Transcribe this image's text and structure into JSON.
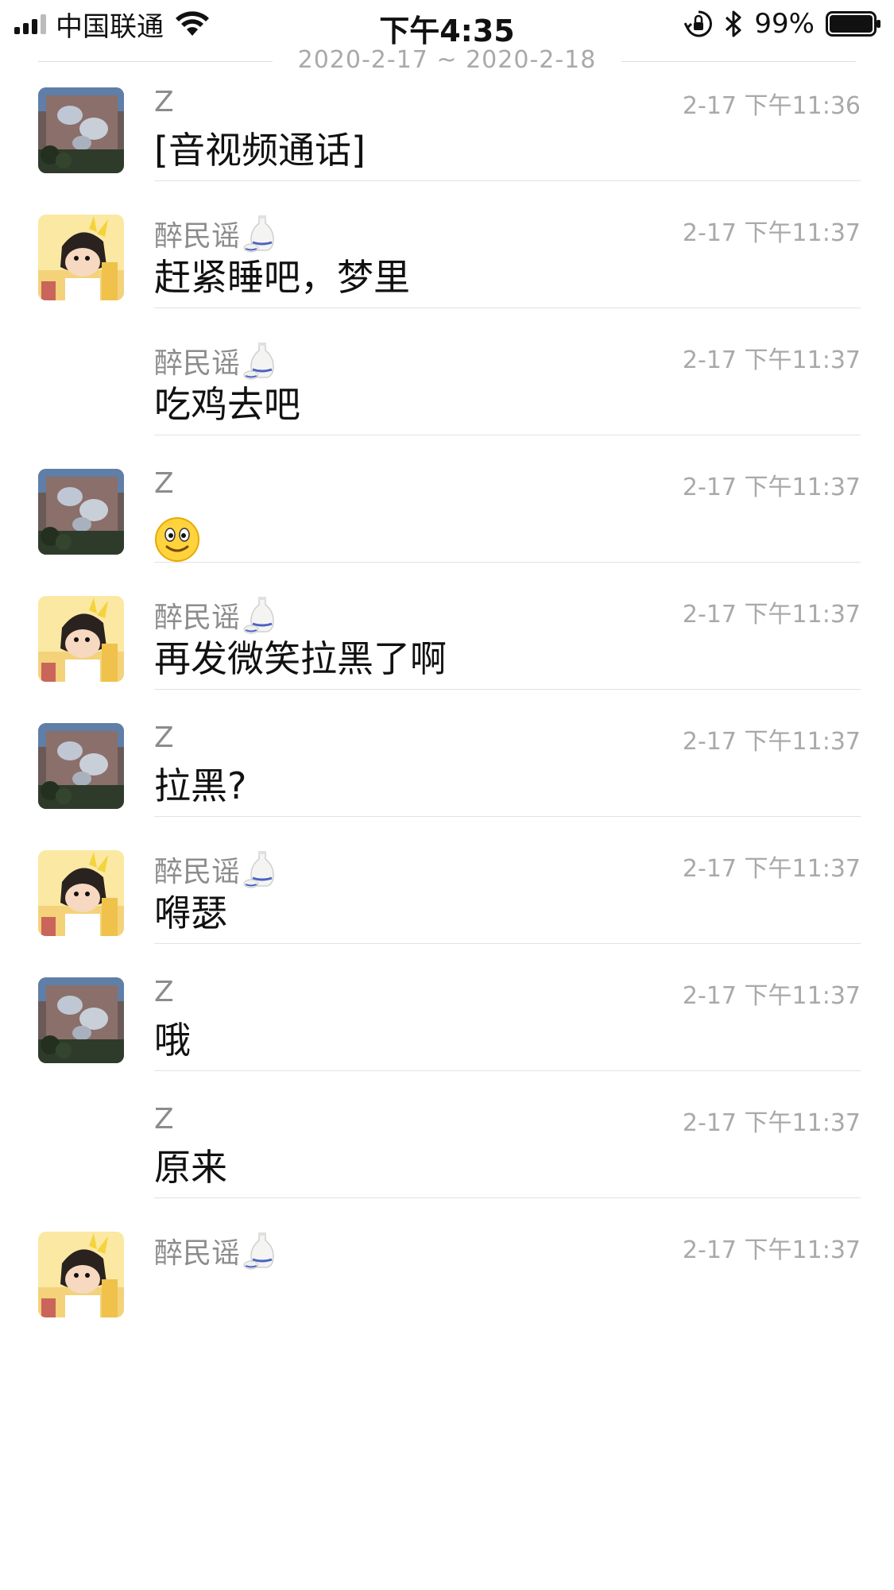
{
  "status_bar": {
    "carrier": "中国联通",
    "time": "下午4:35",
    "battery_percent": "99%",
    "icons": [
      "signal-icon",
      "wifi-icon",
      "orientation-lock-icon",
      "bluetooth-icon",
      "battery-icon"
    ]
  },
  "date_header": {
    "range": "2020-2-17 ~ 2020-2-18"
  },
  "messages": [
    {
      "sender": "Z",
      "time": "2-17 下午11:36",
      "text": "[音视频通话]",
      "avatar": "avatar-z",
      "emoji": ""
    },
    {
      "sender": "醉民谣",
      "time": "2-17 下午11:37",
      "text": "赶紧睡吧，梦里",
      "avatar": "avatar-zuiminyao",
      "emoji": "sake-bottle-icon"
    },
    {
      "sender": "醉民谣",
      "time": "2-17 下午11:37",
      "text": "吃鸡去吧",
      "avatar": "",
      "emoji": "sake-bottle-icon"
    },
    {
      "sender": "Z",
      "time": "2-17 下午11:37",
      "text": "",
      "avatar": "avatar-z",
      "emoji": "smile-emoji"
    },
    {
      "sender": "醉民谣",
      "time": "2-17 下午11:37",
      "text": "再发微笑拉黑了啊",
      "avatar": "avatar-zuiminyao",
      "emoji": "sake-bottle-icon"
    },
    {
      "sender": "Z",
      "time": "2-17 下午11:37",
      "text": "拉黑?",
      "avatar": "avatar-z",
      "emoji": ""
    },
    {
      "sender": "醉民谣",
      "time": "2-17 下午11:37",
      "text": "嘚瑟",
      "avatar": "avatar-zuiminyao",
      "emoji": "sake-bottle-icon"
    },
    {
      "sender": "Z",
      "time": "2-17 下午11:37",
      "text": "哦",
      "avatar": "avatar-z",
      "emoji": ""
    },
    {
      "sender": "Z",
      "time": "2-17 下午11:37",
      "text": "原来",
      "avatar": "",
      "emoji": ""
    },
    {
      "sender": "醉民谣",
      "time": "2-17 下午11:37",
      "text": "",
      "avatar": "avatar-zuiminyao",
      "emoji": "sake-bottle-icon"
    }
  ]
}
